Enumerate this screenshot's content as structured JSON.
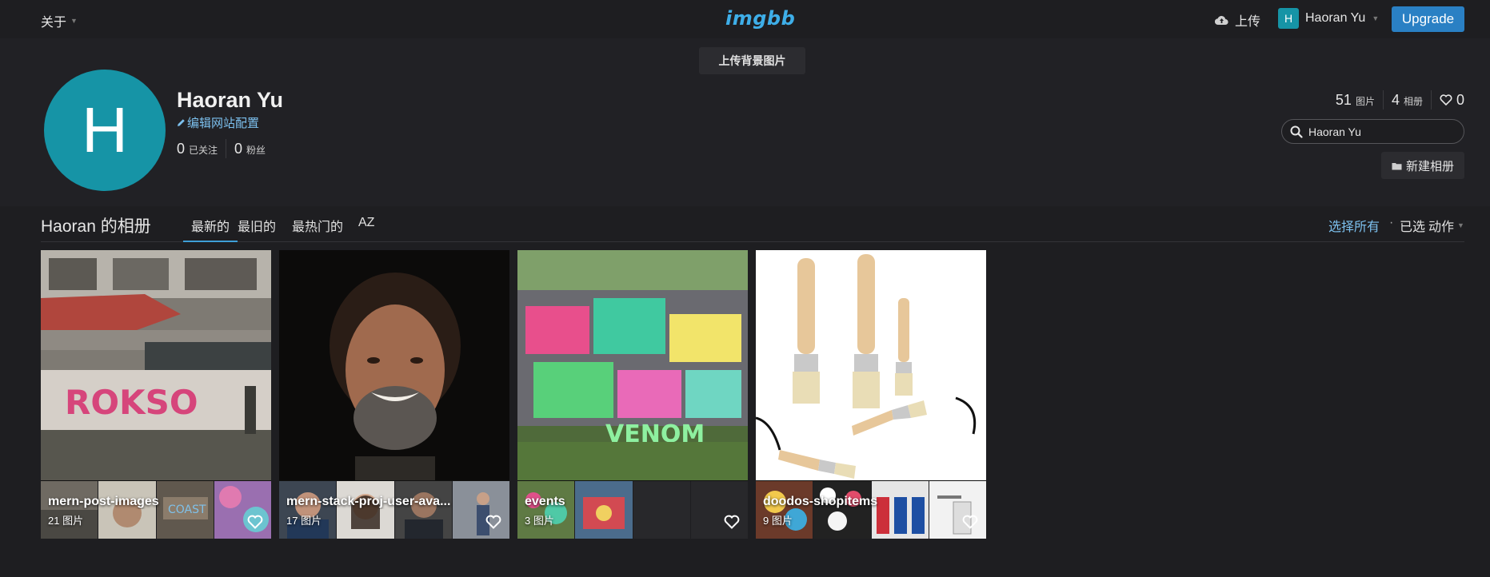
{
  "topbar": {
    "about_label": "关于",
    "logo_text": "imgbb",
    "upload_label": "上传",
    "user_initial": "H",
    "user_name": "Haoran Yu",
    "upgrade_label": "Upgrade"
  },
  "cover": {
    "upload_bg_label": "上传背景图片"
  },
  "profile": {
    "avatar_initial": "H",
    "name": "Haoran Yu",
    "edit_label": "编辑网站配置",
    "following_count": "0",
    "following_label": "已关注",
    "followers_count": "0",
    "followers_label": "粉丝"
  },
  "stats": {
    "images_count": "51",
    "images_label": "图片",
    "albums_count": "4",
    "albums_label": "相册",
    "likes_count": "0"
  },
  "search": {
    "value": "Haoran Yu"
  },
  "new_album_label": "新建相册",
  "album_bar": {
    "title": "Haoran 的相册",
    "tabs": [
      {
        "label": "最新的"
      },
      {
        "label": "最旧的"
      },
      {
        "label": "最热门的"
      },
      {
        "label": "AZ"
      }
    ],
    "select_all": "选择所有",
    "separator": "·",
    "selected": "已选",
    "action": "动作"
  },
  "albums": [
    {
      "name": "mern-post-images",
      "count": "21 图片"
    },
    {
      "name": "mern-stack-proj-user-ava...",
      "count": "17 图片"
    },
    {
      "name": "events",
      "count": "3 图片"
    },
    {
      "name": "doodos-shopitems",
      "count": "9 图片"
    }
  ],
  "colors": {
    "accent": "#2a80c4",
    "link": "#7cc0ee",
    "avatar": "#1694a6",
    "logo": "#3eaee8"
  }
}
